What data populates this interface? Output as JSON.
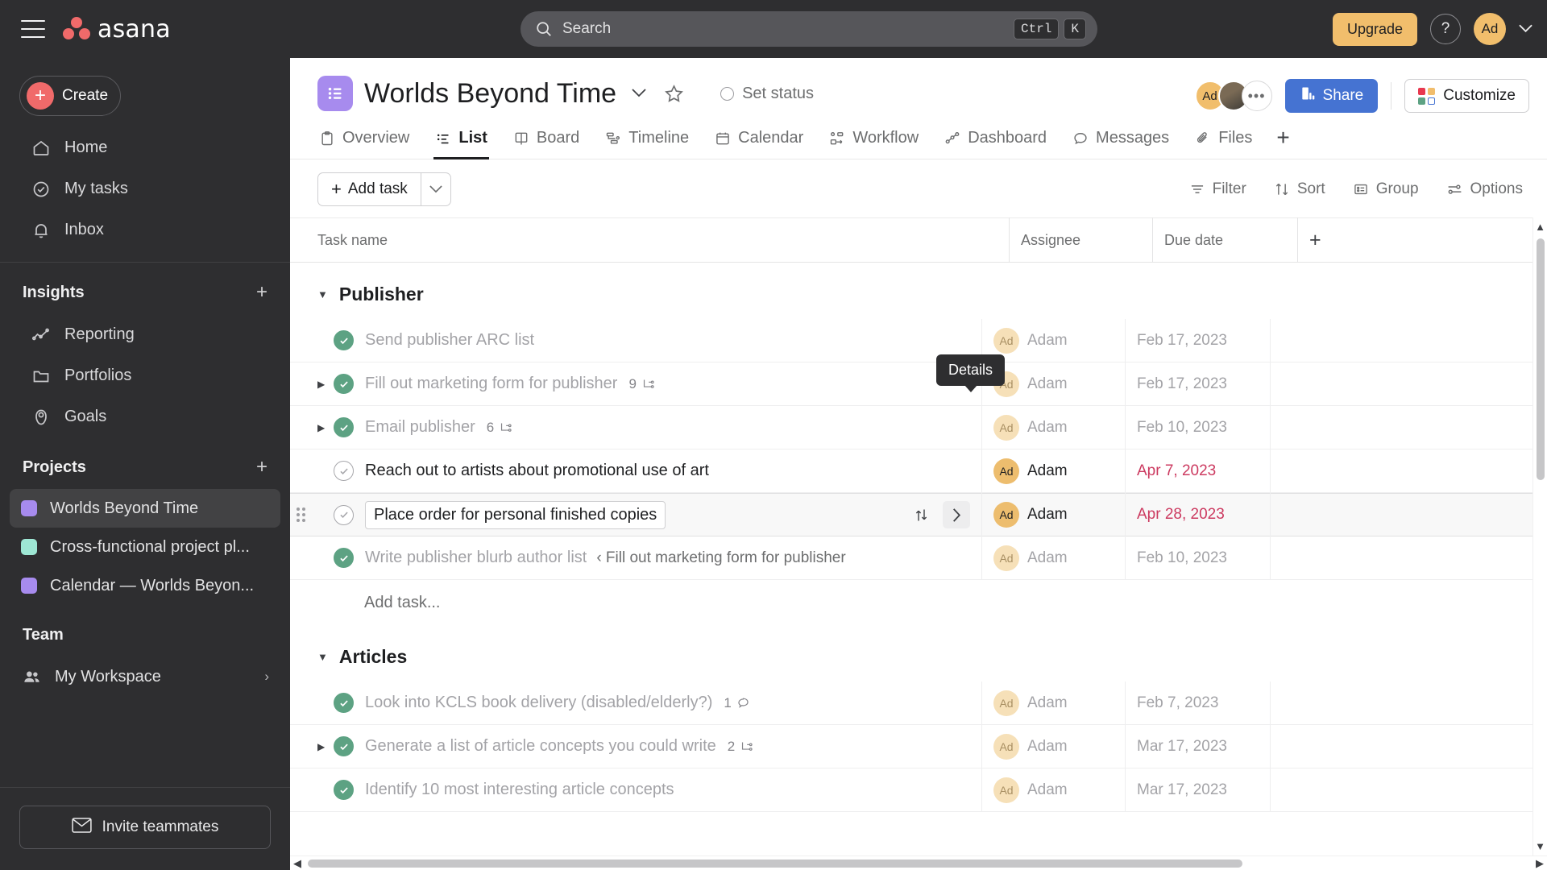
{
  "topbar": {
    "menu_icon": "hamburger-icon",
    "brand": "asana",
    "search": {
      "placeholder": "Search",
      "value": "",
      "icon": "search-icon",
      "kbd": [
        "Ctrl",
        "K"
      ]
    },
    "upgrade_label": "Upgrade",
    "help_label": "?",
    "avatar_initials": "Ad",
    "account_caret": "⌄"
  },
  "sidebar": {
    "create_label": "Create",
    "nav": [
      {
        "label": "Home",
        "icon": "home-icon"
      },
      {
        "label": "My tasks",
        "icon": "check-circle-icon"
      },
      {
        "label": "Inbox",
        "icon": "bell-icon"
      }
    ],
    "insights": {
      "title": "Insights",
      "add_label": "+",
      "items": [
        {
          "label": "Reporting",
          "icon": "reporting-icon"
        },
        {
          "label": "Portfolios",
          "icon": "folder-icon"
        },
        {
          "label": "Goals",
          "icon": "goal-icon"
        }
      ]
    },
    "projects": {
      "title": "Projects",
      "add_label": "+",
      "items": [
        {
          "label": "Worlds Beyond Time",
          "color": "#a78bee",
          "active": true
        },
        {
          "label": "Cross-functional project pl...",
          "color": "#9ee7d4",
          "active": false
        },
        {
          "label": "Calendar — Worlds Beyon...",
          "color": "#a78bee",
          "active": false
        }
      ]
    },
    "team": {
      "title": "Team",
      "items": [
        {
          "label": "My Workspace",
          "icon": "people-icon",
          "chevron": "›"
        }
      ]
    },
    "invite_label": "Invite teammates"
  },
  "project": {
    "title": "Worlds Beyond Time",
    "icon": "list-project-icon",
    "title_caret": "⌄",
    "star_icon": "star-icon",
    "set_status_label": "Set status",
    "members": [
      {
        "initials": "Ad",
        "type": "initials"
      },
      {
        "initials": "",
        "type": "photo"
      },
      {
        "initials": "•••",
        "type": "more"
      }
    ],
    "share_label": "Share",
    "customize_label": "Customize",
    "customize_colors": [
      "#e8384f",
      "#f1bd6c",
      "#5da283",
      "#4573d2"
    ]
  },
  "tabs": [
    {
      "label": "Overview",
      "icon": "clipboard-icon",
      "active": false
    },
    {
      "label": "List",
      "icon": "list-icon",
      "active": true
    },
    {
      "label": "Board",
      "icon": "board-icon",
      "active": false
    },
    {
      "label": "Timeline",
      "icon": "timeline-icon",
      "active": false
    },
    {
      "label": "Calendar",
      "icon": "calendar-icon",
      "active": false
    },
    {
      "label": "Workflow",
      "icon": "workflow-icon",
      "active": false
    },
    {
      "label": "Dashboard",
      "icon": "dashboard-icon",
      "active": false
    },
    {
      "label": "Messages",
      "icon": "message-icon",
      "active": false
    },
    {
      "label": "Files",
      "icon": "paperclip-icon",
      "active": false
    }
  ],
  "tab_add_label": "+",
  "toolbar": {
    "add_task_label": "Add task",
    "add_task_caret": "⌄",
    "filter_label": "Filter",
    "sort_label": "Sort",
    "group_label": "Group",
    "options_label": "Options"
  },
  "table": {
    "headers": {
      "task": "Task name",
      "assignee": "Assignee",
      "due": "Due date",
      "add": "+"
    },
    "sections": [
      {
        "name": "Publisher",
        "collapsed": false,
        "add_task_label": "Add task...",
        "rows": [
          {
            "name": "Send publisher ARC list",
            "done": true,
            "expandable": false,
            "assignee": "Adam",
            "avatar": "Ad",
            "due": "Feb 17, 2023",
            "overdue": false,
            "meta_count": "",
            "meta_icon": ""
          },
          {
            "name": "Fill out marketing form for publisher",
            "done": true,
            "expandable": true,
            "assignee": "Adam",
            "avatar": "Ad",
            "due": "Feb 17, 2023",
            "overdue": false,
            "meta_count": "9",
            "meta_icon": "subtask-icon"
          },
          {
            "name": "Email publisher",
            "done": true,
            "expandable": true,
            "assignee": "Adam",
            "avatar": "Ad",
            "due": "Feb 10, 2023",
            "overdue": false,
            "meta_count": "6",
            "meta_icon": "subtask-icon"
          },
          {
            "name": "Reach out to artists about promotional use of art",
            "done": false,
            "expandable": false,
            "assignee": "Adam",
            "avatar": "Ad",
            "due": "Apr 7, 2023",
            "overdue": true,
            "meta_count": "",
            "meta_icon": ""
          },
          {
            "name": "Place order for personal finished copies",
            "done": false,
            "expandable": false,
            "selected": true,
            "assignee": "Adam",
            "avatar": "Ad",
            "due": "Apr 28, 2023",
            "overdue": true,
            "meta_count": "",
            "meta_icon": ""
          },
          {
            "name": "Write publisher blurb author list",
            "done": true,
            "expandable": false,
            "assignee": "Adam",
            "avatar": "Ad",
            "due": "Feb 10, 2023",
            "overdue": false,
            "meta_count": "",
            "meta_icon": "",
            "parent_ref": "‹ Fill out marketing form for publisher"
          }
        ]
      },
      {
        "name": "Articles",
        "collapsed": false,
        "rows": [
          {
            "name": "Look into KCLS book delivery (disabled/elderly?)",
            "done": true,
            "expandable": false,
            "assignee": "Adam",
            "avatar": "Ad",
            "due": "Feb 7, 2023",
            "overdue": false,
            "meta_count": "1",
            "meta_icon": "comment-icon"
          },
          {
            "name": "Generate a list of article concepts you could write",
            "done": true,
            "expandable": true,
            "assignee": "Adam",
            "avatar": "Ad",
            "due": "Mar 17, 2023",
            "overdue": false,
            "meta_count": "2",
            "meta_icon": "subtask-icon"
          },
          {
            "name": "Identify 10 most interesting article concepts",
            "done": true,
            "expandable": false,
            "assignee": "Adam",
            "avatar": "Ad",
            "due": "Mar 17, 2023",
            "overdue": false,
            "meta_count": "",
            "meta_icon": ""
          }
        ]
      }
    ]
  },
  "tooltip": {
    "text": "Details"
  },
  "row_actions": {
    "move_icon": "move-icon",
    "details_icon": "chevron-right-icon"
  },
  "colors": {
    "brand_red": "#f06a6a",
    "accent_blue": "#4573d2",
    "upgrade_amber": "#f1be6c",
    "overdue_red": "#cc3a60",
    "done_green": "#5da283",
    "project_purple": "#a78bee"
  }
}
